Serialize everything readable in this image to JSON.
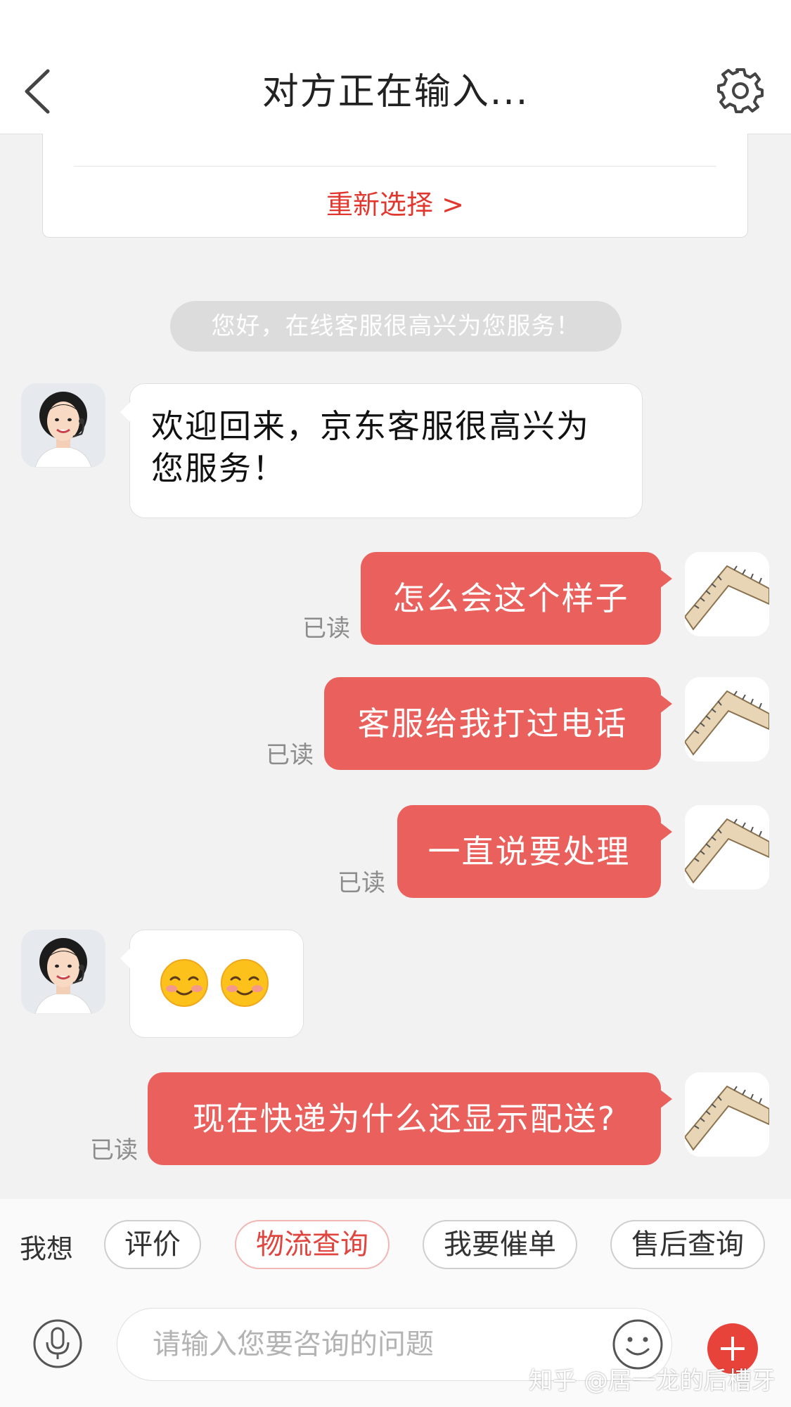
{
  "header": {
    "title": "对方正在输入...",
    "back_icon": "chevron-left-icon",
    "settings_icon": "gear-icon"
  },
  "card": {
    "reselect_link": "重新选择 >"
  },
  "system_message": "您好，在线客服很高兴为您服务！",
  "messages": [
    {
      "sender": "agent",
      "line1": "欢迎回来，京东客服很高兴为",
      "line2": "您服务！"
    },
    {
      "sender": "user",
      "text": "怎么会这个样子",
      "status": "已读"
    },
    {
      "sender": "user",
      "text": "客服给我打过电话",
      "status": "已读"
    },
    {
      "sender": "user",
      "text": "一直说要处理",
      "status": "已读"
    },
    {
      "sender": "agent",
      "emojis": [
        "smiling-blush-emoji",
        "smiling-blush-emoji"
      ]
    },
    {
      "sender": "user",
      "text": "现在快递为什么还显示配送?",
      "status": "已读"
    }
  ],
  "quick_bar": {
    "label": "我想",
    "chips": [
      "评价",
      "物流查询",
      "我要催单",
      "售后查询"
    ],
    "active_chip": "物流查询"
  },
  "input_bar": {
    "placeholder": "请输入您要咨询的问题",
    "value": "",
    "mic_icon": "microphone-icon",
    "emoji_icon": "smiley-icon",
    "plus_icon": "plus-icon"
  },
  "watermark": "知乎 @居一龙的后槽牙",
  "colors": {
    "accent": "#e9605c",
    "link": "#e0382f",
    "background": "#f2f2f2"
  }
}
